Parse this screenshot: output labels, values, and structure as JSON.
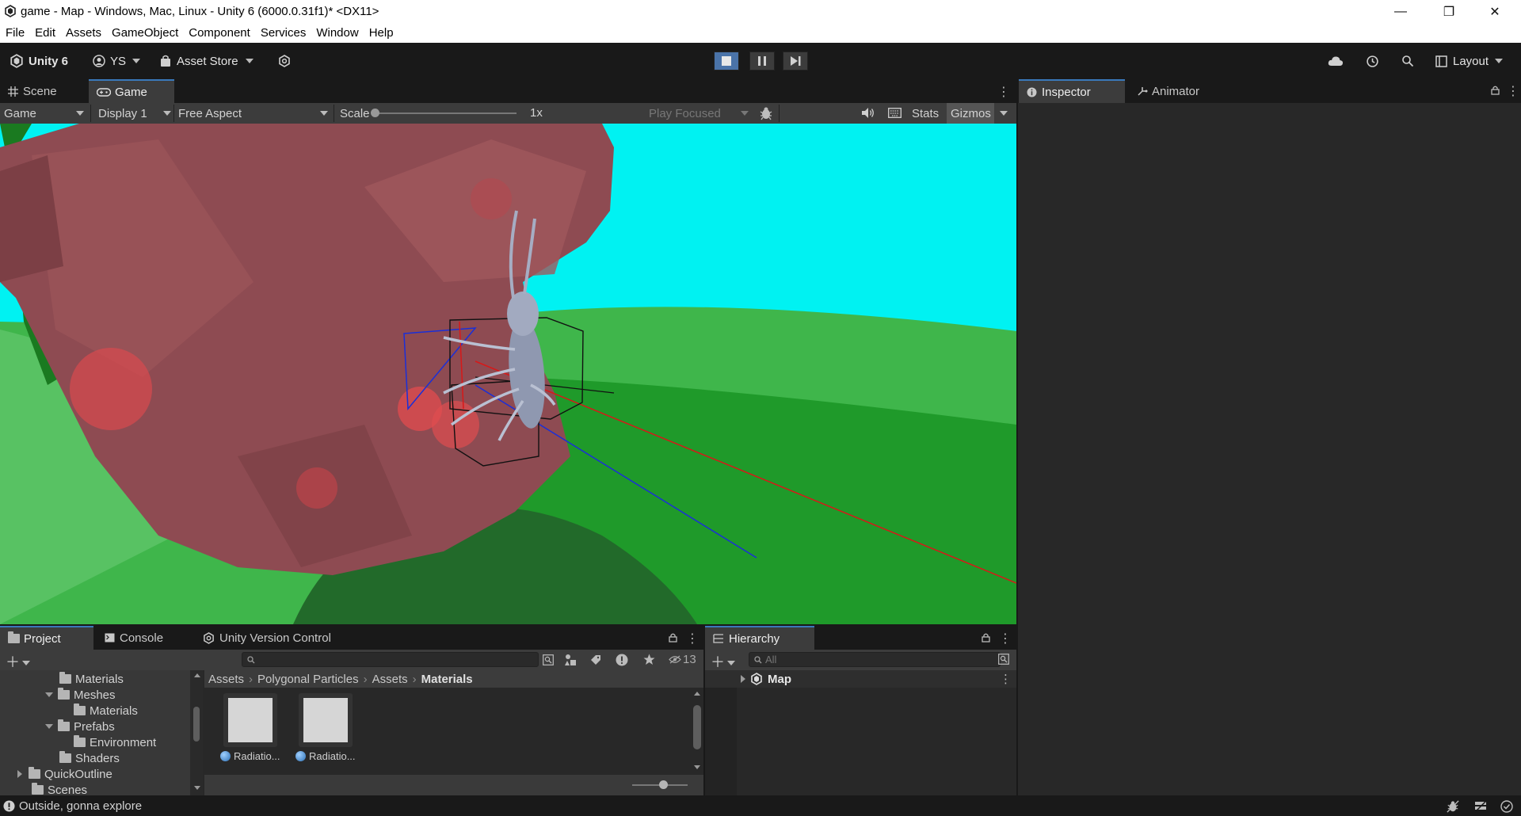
{
  "window": {
    "title": "game - Map - Windows, Mac, Linux - Unity 6 (6000.0.31f1)* <DX11>",
    "minimize": "—",
    "maximize": "❐",
    "close": "✕"
  },
  "menu": [
    "File",
    "Edit",
    "Assets",
    "GameObject",
    "Component",
    "Services",
    "Window",
    "Help"
  ],
  "toolbar": {
    "unity_label": "Unity 6",
    "account_label": "YS",
    "asset_store_label": "Asset Store",
    "layout_label": "Layout"
  },
  "game_panel": {
    "tabs": [
      "Scene",
      "Game"
    ],
    "active_tab": "Game",
    "mode": "Game",
    "display": "Display 1",
    "aspect": "Free Aspect",
    "scale_label": "Scale",
    "scale_value": "1x",
    "play_focused": "Play Focused",
    "stats": "Stats",
    "gizmos": "Gizmos"
  },
  "inspector_panel": {
    "tabs": [
      "Inspector",
      "Animator"
    ],
    "active_tab": "Inspector"
  },
  "project_panel": {
    "tabs": [
      "Project",
      "Console",
      "Unity Version Control"
    ],
    "active_tab": "Project",
    "hidden_count": "13",
    "search_placeholder": "",
    "tree": [
      {
        "label": "Materials",
        "level": 3,
        "expanded": null
      },
      {
        "label": "Meshes",
        "level": 2,
        "expanded": true
      },
      {
        "label": "Materials",
        "level": 3,
        "expanded": null
      },
      {
        "label": "Prefabs",
        "level": 2,
        "expanded": true
      },
      {
        "label": "Environment",
        "level": 3,
        "expanded": null
      },
      {
        "label": "Shaders",
        "level": 2,
        "expanded": null
      },
      {
        "label": "QuickOutline",
        "level": 1,
        "expanded": false
      },
      {
        "label": "Scenes",
        "level": 1,
        "expanded": null
      }
    ],
    "breadcrumb": [
      "Assets",
      "Polygonal Particles",
      "Assets",
      "Materials"
    ],
    "assets": [
      {
        "label": "Radiatio..."
      },
      {
        "label": "Radiatio..."
      }
    ]
  },
  "hierarchy_panel": {
    "tab": "Hierarchy",
    "search_placeholder": "All",
    "root": "Map"
  },
  "status": {
    "message": "Outside, gonna explore"
  },
  "colors": {
    "sky": "#00f2f2",
    "ground": "#34b043",
    "rock": "#8a4a51",
    "accent": "#3a79bb"
  }
}
